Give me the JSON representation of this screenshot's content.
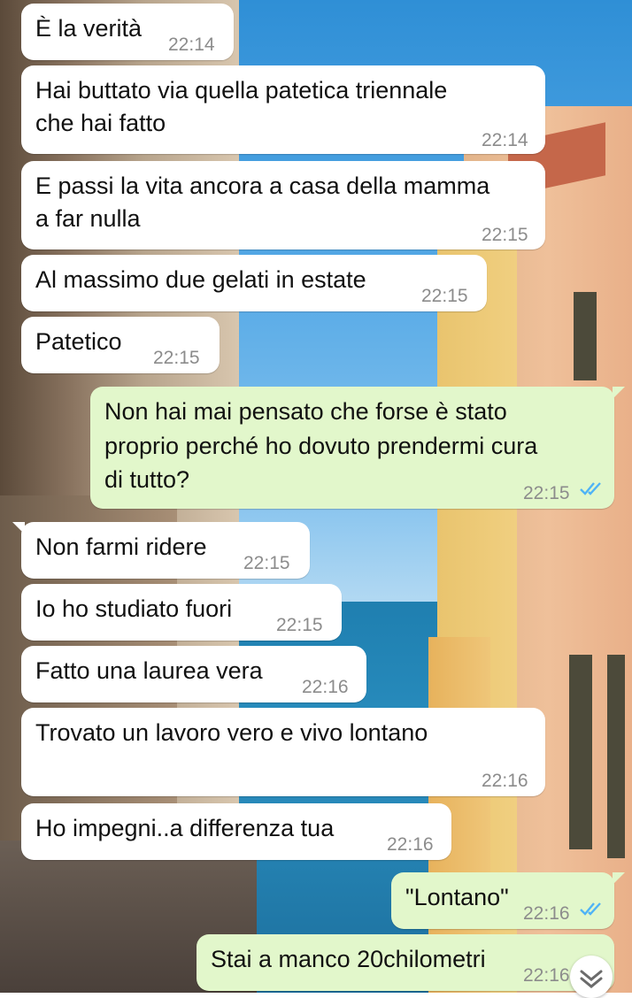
{
  "messages": [
    {
      "dir": "in",
      "lines": [
        "È la verità"
      ],
      "time": "22:14"
    },
    {
      "dir": "in",
      "lines": [
        "Hai buttato via quella patetica triennale",
        "che hai fatto"
      ],
      "time": "22:14"
    },
    {
      "dir": "in",
      "lines": [
        "E passi la vita ancora a casa della mamma",
        "a far nulla"
      ],
      "time": "22:15"
    },
    {
      "dir": "in",
      "lines": [
        "Al massimo due gelati in estate"
      ],
      "time": "22:15"
    },
    {
      "dir": "in",
      "lines": [
        "Patetico"
      ],
      "time": "22:15"
    },
    {
      "dir": "out",
      "lines": [
        "Non hai mai pensato che forse è stato",
        "proprio perché ho dovuto prendermi cura",
        "di tutto?"
      ],
      "time": "22:15",
      "status": "read"
    },
    {
      "dir": "in",
      "lines": [
        "Non farmi ridere"
      ],
      "time": "22:15"
    },
    {
      "dir": "in",
      "lines": [
        "Io ho studiato fuori"
      ],
      "time": "22:15"
    },
    {
      "dir": "in",
      "lines": [
        "Fatto una laurea vera"
      ],
      "time": "22:16"
    },
    {
      "dir": "in",
      "lines": [
        "Trovato un lavoro vero e vivo lontano"
      ],
      "time": "22:16"
    },
    {
      "dir": "in",
      "lines": [
        "Ho impegni..a differenza tua"
      ],
      "time": "22:16"
    },
    {
      "dir": "out",
      "lines": [
        "\"Lontano\""
      ],
      "time": "22:16",
      "status": "read"
    },
    {
      "dir": "out",
      "lines": [
        "Stai a manco 20chilometri"
      ],
      "time": "22:16",
      "status": "read"
    }
  ],
  "colors": {
    "incoming": "#ffffff",
    "outgoing": "#e2f7cb",
    "read_ticks": "#4fb3f6",
    "timestamp": "#8c8c8c"
  },
  "icons": {
    "read_status": "double-check-icon",
    "scroll_down": "double-chevron-down-icon"
  }
}
